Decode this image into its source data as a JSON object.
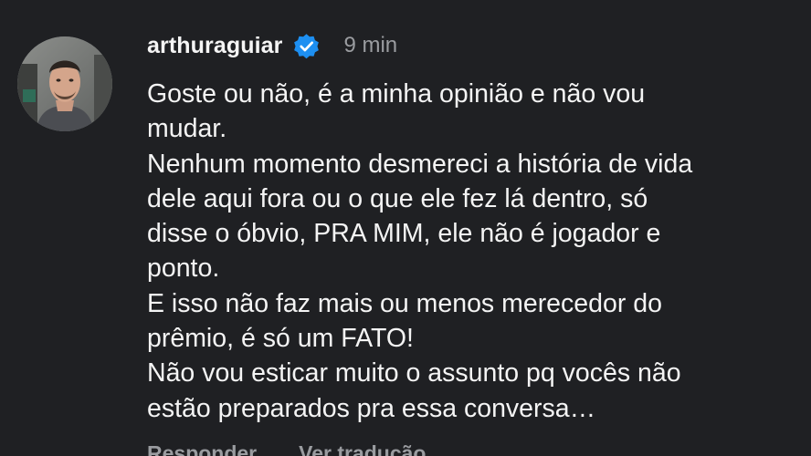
{
  "comment": {
    "username": "arthuraguiar",
    "verified_icon": "verified-badge-icon",
    "timestamp": "9 min",
    "body_lines": [
      "Goste ou não, é a minha opinião e não vou",
      "mudar.",
      "Nenhum momento desmereci a história de vida",
      "dele aqui fora ou o que ele fez lá dentro, só",
      "disse o óbvio, PRA MIM, ele não é jogador e",
      "ponto.",
      "E isso não faz mais ou menos merecedor do",
      "prêmio, é só um FATO!",
      "Não vou esticar muito o assunto pq vocês não",
      "estão preparados pra essa conversa…"
    ],
    "actions": {
      "reply": "Responder",
      "translate": "Ver tradução"
    }
  },
  "colors": {
    "background": "#1f2023",
    "text": "#f4f4f4",
    "muted": "#9a9ca0",
    "verified": "#1d8ff1"
  }
}
